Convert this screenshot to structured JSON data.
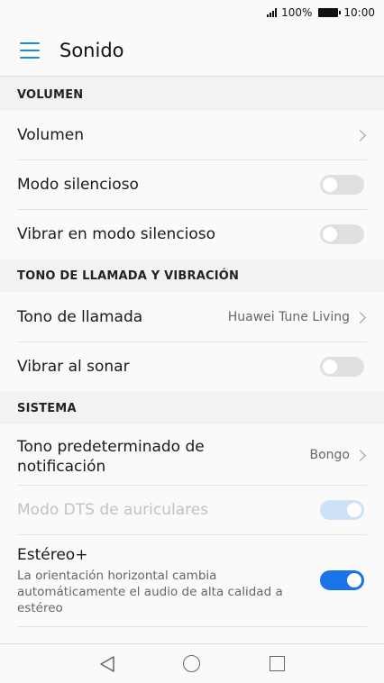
{
  "status_bar": {
    "battery_percent": "100%",
    "time": "10:00",
    "icons": [
      "signal-icon",
      "battery-icon"
    ]
  },
  "app_bar": {
    "title": "Sonido",
    "menu_icon": "menu-icon"
  },
  "sections": {
    "volumen": {
      "header": "VOLUMEN",
      "rows": [
        {
          "label": "Volumen",
          "control": "chevron"
        },
        {
          "label": "Modo silencioso",
          "control": "toggle",
          "on": false
        },
        {
          "label": "Vibrar en modo silencioso",
          "control": "toggle",
          "on": false
        }
      ]
    },
    "tono": {
      "header": "TONO DE LLAMADA Y VIBRACIÓN",
      "rows": [
        {
          "label": "Tono de llamada",
          "value": "Huawei Tune Living",
          "control": "chevron"
        },
        {
          "label": "Vibrar al sonar",
          "control": "toggle",
          "on": false
        }
      ]
    },
    "sistema": {
      "header": "SISTEMA",
      "rows": [
        {
          "label": "Tono predeterminado de notificación",
          "value": "Bongo",
          "control": "chevron"
        },
        {
          "label": "Modo DTS de auriculares",
          "control": "toggle",
          "on": true,
          "disabled": true
        },
        {
          "label": "Estéreo+",
          "subtitle": "La orientación horizontal cambia automáticamente el audio de alta calidad a estéreo",
          "control": "toggle",
          "on": true
        }
      ]
    }
  },
  "nav_bar": {
    "icons": [
      "back-icon",
      "home-icon",
      "recents-icon"
    ]
  },
  "colors": {
    "accent": "#1a73e8",
    "toggle_off": "#e0e0e0",
    "toggle_disabled": "#cfe1f7",
    "background": "#f2f2f2"
  }
}
